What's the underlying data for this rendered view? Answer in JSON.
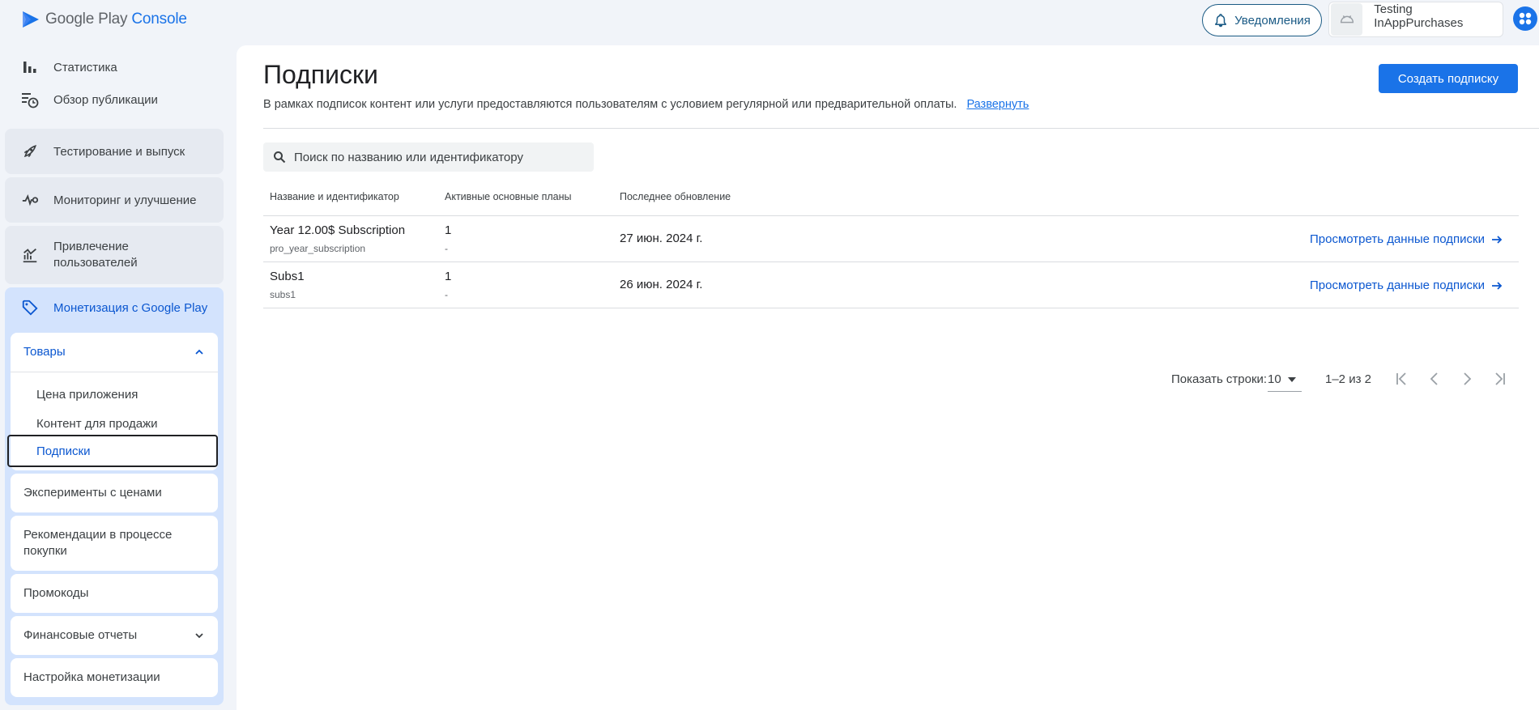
{
  "header": {
    "brand_google_play": "Google Play",
    "brand_console": "Console",
    "notifications_label": "Уведомления",
    "app_name": "Testing InAppPurchases"
  },
  "sidebar": {
    "statistics": "Статистика",
    "publishing_overview": "Обзор публикации",
    "testing_release": "Тестирование и выпуск",
    "monitoring": "Мониторинг и улучшение",
    "user_acquisition": "Привлечение пользователей",
    "monetization": "Монетизация с Google Play",
    "products": {
      "label": "Товары",
      "items": [
        "Цена приложения",
        "Контент для продажи",
        "Подписки"
      ]
    },
    "price_experiments": "Эксперименты с ценами",
    "purchase_recommendations": "Рекомендации в процессе покупки",
    "promo_codes": "Промокоды",
    "financial_reports": "Финансовые отчеты",
    "monetization_setup": "Настройка монетизации"
  },
  "main": {
    "title": "Подписки",
    "description": "В рамках подписок контент или услуги предоставляются пользователям с условием регулярной или предварительной оплаты.",
    "expand_link": "Развернуть",
    "create_button": "Создать подписку",
    "search_placeholder": "Поиск по названию или идентификатору",
    "table": {
      "columns": [
        "Название и идентификатор",
        "Активные основные планы",
        "Последнее обновление"
      ],
      "rows": [
        {
          "name": "Year 12.00$ Subscription",
          "id": "pro_year_subscription",
          "plans": "1",
          "plans_sub": "-",
          "updated": "27 июн. 2024 г.",
          "link": "Просмотреть данные подписки"
        },
        {
          "name": "Subs1",
          "id": "subs1",
          "plans": "1",
          "plans_sub": "-",
          "updated": "26 июн. 2024 г.",
          "link": "Просмотреть данные подписки"
        }
      ]
    },
    "pagination": {
      "rows_label": "Показать строки:",
      "rows_value": "10",
      "range": "1–2 из 2"
    }
  },
  "colors": {
    "accent": "#1a73e8",
    "link": "#0b57d0",
    "active_block": "#d3e3fd",
    "nav_card": "#e6eaf1"
  }
}
